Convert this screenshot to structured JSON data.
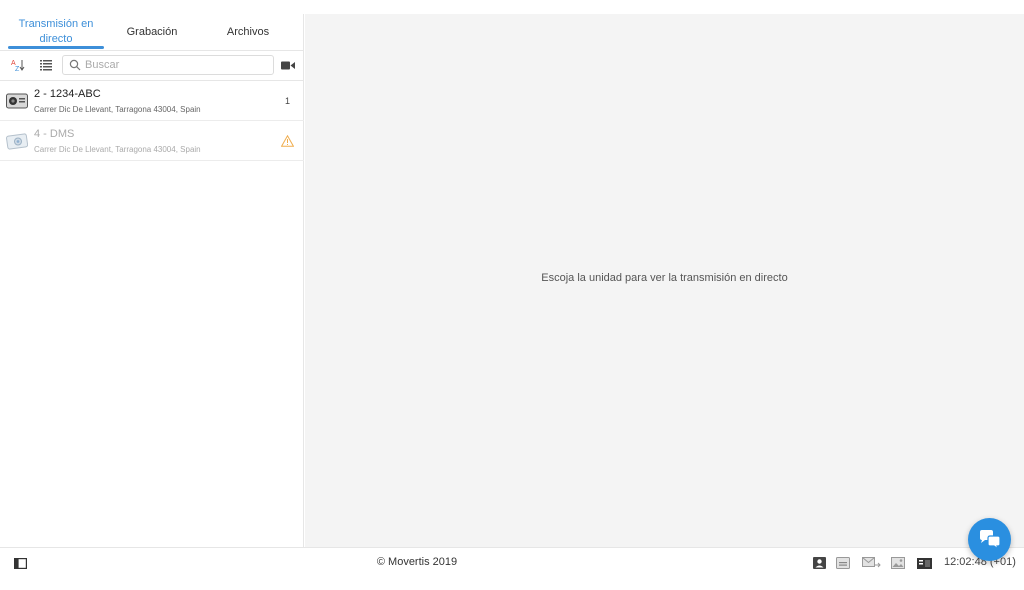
{
  "tabs": [
    {
      "label_line1": "Transmisión en",
      "label_line2": "directo",
      "active": true
    },
    {
      "label": "Grabación"
    },
    {
      "label": "Archivos"
    }
  ],
  "toolbar": {
    "sort_icon": "sort-az-icon",
    "list_icon": "list-view-icon",
    "search_placeholder": "Buscar",
    "search_value": "",
    "camera_icon": "video-camera-icon"
  },
  "units": [
    {
      "name": "2 - 1234-ABC",
      "address": "Carrer Dic De Llevant, Tarragona 43004, Spain",
      "count": "1",
      "disabled": false
    },
    {
      "name": "4 - DMS",
      "address": "Carrer Dic De Llevant, Tarragona 43004, Spain",
      "disabled": true,
      "status": "warning"
    }
  ],
  "main": {
    "message": "Escoja la unidad para ver la transmisión en directo"
  },
  "footer": {
    "copyright": "© Movertis 2019",
    "clock": "12:02:48 (+01)"
  },
  "colors": {
    "accent": "#3d8fd9",
    "chat": "#2a8fe0",
    "warning": "#f0ad4e",
    "main_bg": "#f4f4f4"
  }
}
